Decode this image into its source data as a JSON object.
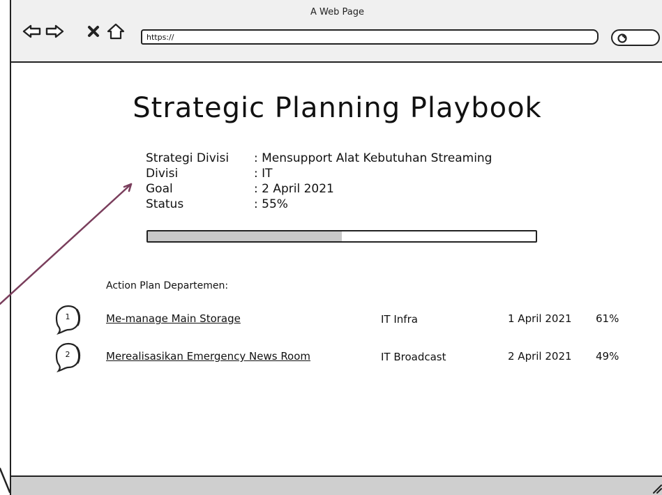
{
  "window": {
    "title": "A Web Page",
    "url": "https://"
  },
  "page": {
    "title": "Strategic Planning Playbook",
    "info": [
      {
        "key": "Strategi Divisi",
        "value": ": Mensupport Alat Kebutuhan Streaming"
      },
      {
        "key": "Divisi",
        "value": ": IT"
      },
      {
        "key": "Goal",
        "value": ": 2 April 2021"
      },
      {
        "key": "Status",
        "value": ": 55%"
      }
    ],
    "progress_fraction": 0.5,
    "section_label": "Action Plan Departemen:",
    "plans": [
      {
        "num": "1",
        "title": "Me-manage Main Storage",
        "dept": "IT Infra",
        "date": "1 April 2021",
        "pct": "61%"
      },
      {
        "num": "2",
        "title": "Merealisasikan Emergency News Room",
        "dept": "IT Broadcast",
        "date": "2 April 2021",
        "pct": "49%"
      }
    ]
  },
  "icons": {
    "back": "back-arrow-icon",
    "forward": "forward-arrow-icon",
    "stop": "close-icon",
    "home": "home-icon",
    "search": "search-icon",
    "badge": "speech-bubble-icon",
    "resize": "resize-grip-icon"
  },
  "colors": {
    "chrome": "#f0f0f0",
    "progress_fill": "#c8c8c8",
    "status_bar": "#cfcfcf",
    "annotation_arrow": "#7a3e5c"
  }
}
